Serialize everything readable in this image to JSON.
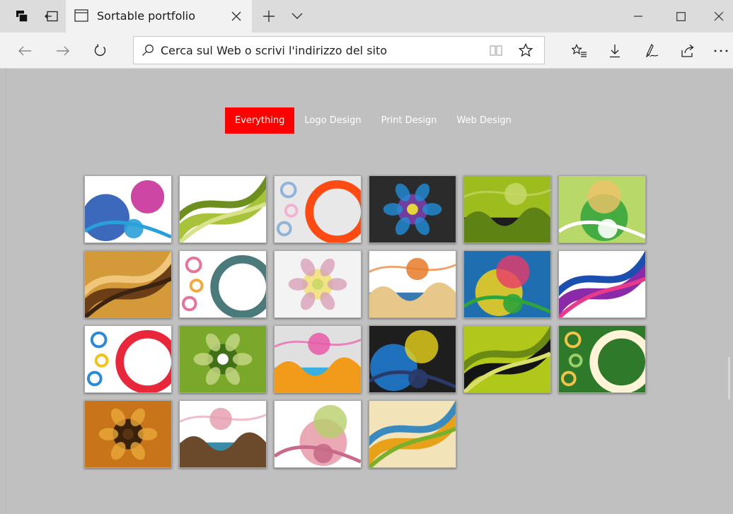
{
  "browser": {
    "tab_title": "Sortable portfolio",
    "address_placeholder": "Cerca sul Web o scrivi l'indirizzo del sito"
  },
  "portfolio": {
    "filters": [
      {
        "label": "Everything",
        "active": true
      },
      {
        "label": "Logo Design",
        "active": false
      },
      {
        "label": "Print Design",
        "active": false
      },
      {
        "label": "Web Design",
        "active": false
      }
    ],
    "thumbnails": [
      {
        "name": "colorful-swirl-bokeh",
        "colors": [
          "#ffffff",
          "#1a4fb0",
          "#c2188c",
          "#2aa0d8"
        ]
      },
      {
        "name": "green-floral-vines",
        "colors": [
          "#ffffff",
          "#a8c23a",
          "#6d8f1f",
          "#d9e28a"
        ]
      },
      {
        "name": "orange-circle-rings",
        "colors": [
          "#e8e8e8",
          "#ff4a14",
          "#8fb4d8",
          "#f5b2d0"
        ]
      },
      {
        "name": "purple-blue-stripes",
        "colors": [
          "#2b2b2b",
          "#7a3fa8",
          "#1f8fd8",
          "#e5d43a"
        ]
      },
      {
        "name": "green-landscape-silhouette",
        "colors": [
          "#9dbd1e",
          "#5f8214",
          "#1d1d1d",
          "#c8d96a"
        ]
      },
      {
        "name": "green-flower-waves",
        "colors": [
          "#b8d86a",
          "#2fa43a",
          "#f0c36a",
          "#ffffff"
        ]
      },
      {
        "name": "brown-bonsai-vintage",
        "colors": [
          "#d49a3a",
          "#6b3e17",
          "#f0c77a",
          "#3a2410"
        ]
      },
      {
        "name": "white-floral-ornament",
        "colors": [
          "#ffffff",
          "#4a7a7a",
          "#e8729a",
          "#f2a83a"
        ]
      },
      {
        "name": "yellow-flower-outline",
        "colors": [
          "#f3f3f3",
          "#f1e27a",
          "#d8a0b8",
          "#cfd86a"
        ]
      },
      {
        "name": "beige-butterfly-splash",
        "colors": [
          "#ffffff",
          "#e8c88a",
          "#3a7ab0",
          "#e87a2a"
        ]
      },
      {
        "name": "tropical-flower-burst",
        "colors": [
          "#1f6fb0",
          "#f3d21a",
          "#e83a6a",
          "#2fa43a"
        ]
      },
      {
        "name": "purple-swirl-floral",
        "colors": [
          "#ffffff",
          "#8a2aa8",
          "#1a4fb0",
          "#e83a8a"
        ]
      },
      {
        "name": "rainbow-paisley-drops",
        "colors": [
          "#ffffff",
          "#e8283a",
          "#2a8ad8",
          "#f3c21a"
        ]
      },
      {
        "name": "green-grunge-floral",
        "colors": [
          "#7aa82a",
          "#3a6a14",
          "#c8d88a",
          "#ffffff"
        ]
      },
      {
        "name": "colored-circles-pattern",
        "colors": [
          "#e0e0e0",
          "#f29a1a",
          "#3ab0e0",
          "#e85aa8"
        ]
      },
      {
        "name": "blue-yellow-arcs",
        "colors": [
          "#1e1e1e",
          "#1f7fd8",
          "#e8d21a",
          "#2a3a6a"
        ]
      },
      {
        "name": "city-silhouette-green",
        "colors": [
          "#b0c81a",
          "#141414",
          "#6a8a14",
          "#d8e06a"
        ]
      },
      {
        "name": "frangipani-green",
        "colors": [
          "#2f7a2a",
          "#fff4d8",
          "#f3c24a",
          "#9ad06a"
        ]
      },
      {
        "name": "grunge-tree-sunset",
        "colors": [
          "#c8741a",
          "#2a1808",
          "#e8a83a",
          "#5a3214"
        ]
      },
      {
        "name": "vine-ornament-white",
        "colors": [
          "#ffffff",
          "#6a4a2a",
          "#3a8aa8",
          "#e8a0b0"
        ]
      },
      {
        "name": "pink-rose-sketch",
        "colors": [
          "#ffffff",
          "#e89aa8",
          "#b8d06a",
          "#c86a8a"
        ]
      },
      {
        "name": "orange-leaf-collage",
        "colors": [
          "#f3e3b8",
          "#e8a21a",
          "#3a8ac0",
          "#7ab02a"
        ]
      }
    ]
  }
}
